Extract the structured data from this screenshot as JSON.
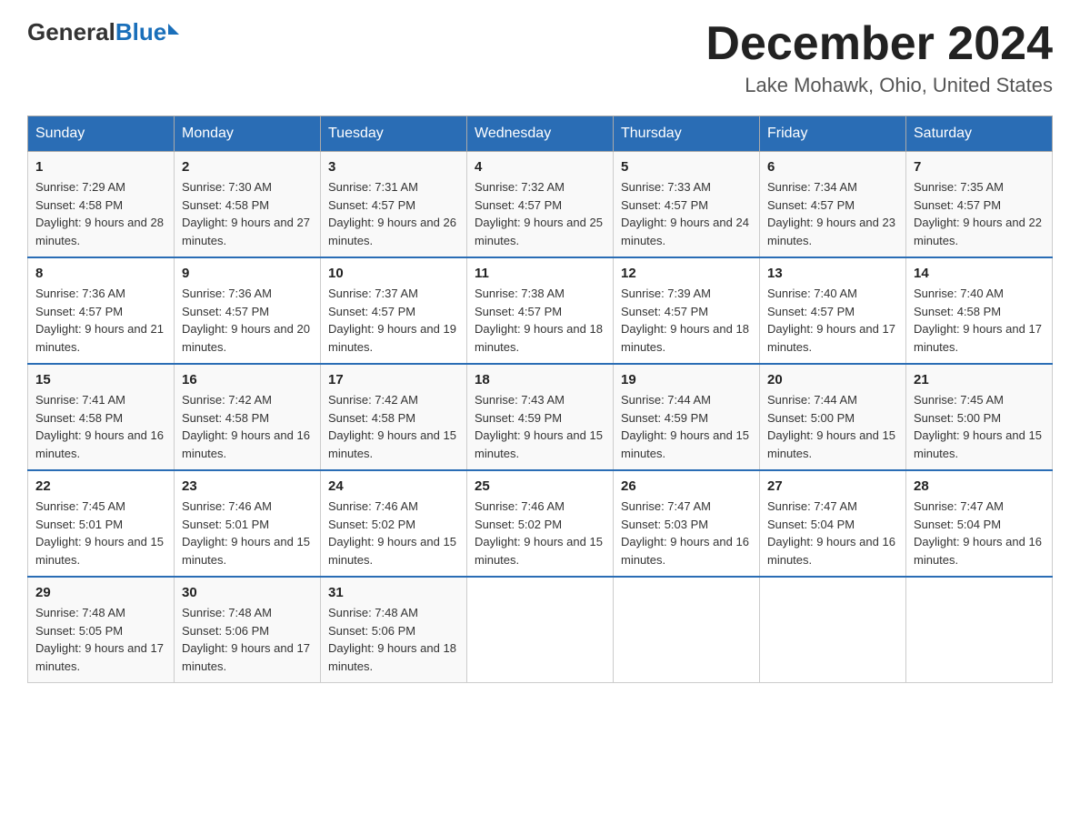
{
  "logo": {
    "general": "General",
    "blue": "Blue",
    "triangle": "▶"
  },
  "title": "December 2024",
  "subtitle": "Lake Mohawk, Ohio, United States",
  "weekdays": [
    "Sunday",
    "Monday",
    "Tuesday",
    "Wednesday",
    "Thursday",
    "Friday",
    "Saturday"
  ],
  "weeks": [
    [
      {
        "day": "1",
        "sunrise": "7:29 AM",
        "sunset": "4:58 PM",
        "daylight": "9 hours and 28 minutes."
      },
      {
        "day": "2",
        "sunrise": "7:30 AM",
        "sunset": "4:58 PM",
        "daylight": "9 hours and 27 minutes."
      },
      {
        "day": "3",
        "sunrise": "7:31 AM",
        "sunset": "4:57 PM",
        "daylight": "9 hours and 26 minutes."
      },
      {
        "day": "4",
        "sunrise": "7:32 AM",
        "sunset": "4:57 PM",
        "daylight": "9 hours and 25 minutes."
      },
      {
        "day": "5",
        "sunrise": "7:33 AM",
        "sunset": "4:57 PM",
        "daylight": "9 hours and 24 minutes."
      },
      {
        "day": "6",
        "sunrise": "7:34 AM",
        "sunset": "4:57 PM",
        "daylight": "9 hours and 23 minutes."
      },
      {
        "day": "7",
        "sunrise": "7:35 AM",
        "sunset": "4:57 PM",
        "daylight": "9 hours and 22 minutes."
      }
    ],
    [
      {
        "day": "8",
        "sunrise": "7:36 AM",
        "sunset": "4:57 PM",
        "daylight": "9 hours and 21 minutes."
      },
      {
        "day": "9",
        "sunrise": "7:36 AM",
        "sunset": "4:57 PM",
        "daylight": "9 hours and 20 minutes."
      },
      {
        "day": "10",
        "sunrise": "7:37 AM",
        "sunset": "4:57 PM",
        "daylight": "9 hours and 19 minutes."
      },
      {
        "day": "11",
        "sunrise": "7:38 AM",
        "sunset": "4:57 PM",
        "daylight": "9 hours and 18 minutes."
      },
      {
        "day": "12",
        "sunrise": "7:39 AM",
        "sunset": "4:57 PM",
        "daylight": "9 hours and 18 minutes."
      },
      {
        "day": "13",
        "sunrise": "7:40 AM",
        "sunset": "4:57 PM",
        "daylight": "9 hours and 17 minutes."
      },
      {
        "day": "14",
        "sunrise": "7:40 AM",
        "sunset": "4:58 PM",
        "daylight": "9 hours and 17 minutes."
      }
    ],
    [
      {
        "day": "15",
        "sunrise": "7:41 AM",
        "sunset": "4:58 PM",
        "daylight": "9 hours and 16 minutes."
      },
      {
        "day": "16",
        "sunrise": "7:42 AM",
        "sunset": "4:58 PM",
        "daylight": "9 hours and 16 minutes."
      },
      {
        "day": "17",
        "sunrise": "7:42 AM",
        "sunset": "4:58 PM",
        "daylight": "9 hours and 15 minutes."
      },
      {
        "day": "18",
        "sunrise": "7:43 AM",
        "sunset": "4:59 PM",
        "daylight": "9 hours and 15 minutes."
      },
      {
        "day": "19",
        "sunrise": "7:44 AM",
        "sunset": "4:59 PM",
        "daylight": "9 hours and 15 minutes."
      },
      {
        "day": "20",
        "sunrise": "7:44 AM",
        "sunset": "5:00 PM",
        "daylight": "9 hours and 15 minutes."
      },
      {
        "day": "21",
        "sunrise": "7:45 AM",
        "sunset": "5:00 PM",
        "daylight": "9 hours and 15 minutes."
      }
    ],
    [
      {
        "day": "22",
        "sunrise": "7:45 AM",
        "sunset": "5:01 PM",
        "daylight": "9 hours and 15 minutes."
      },
      {
        "day": "23",
        "sunrise": "7:46 AM",
        "sunset": "5:01 PM",
        "daylight": "9 hours and 15 minutes."
      },
      {
        "day": "24",
        "sunrise": "7:46 AM",
        "sunset": "5:02 PM",
        "daylight": "9 hours and 15 minutes."
      },
      {
        "day": "25",
        "sunrise": "7:46 AM",
        "sunset": "5:02 PM",
        "daylight": "9 hours and 15 minutes."
      },
      {
        "day": "26",
        "sunrise": "7:47 AM",
        "sunset": "5:03 PM",
        "daylight": "9 hours and 16 minutes."
      },
      {
        "day": "27",
        "sunrise": "7:47 AM",
        "sunset": "5:04 PM",
        "daylight": "9 hours and 16 minutes."
      },
      {
        "day": "28",
        "sunrise": "7:47 AM",
        "sunset": "5:04 PM",
        "daylight": "9 hours and 16 minutes."
      }
    ],
    [
      {
        "day": "29",
        "sunrise": "7:48 AM",
        "sunset": "5:05 PM",
        "daylight": "9 hours and 17 minutes."
      },
      {
        "day": "30",
        "sunrise": "7:48 AM",
        "sunset": "5:06 PM",
        "daylight": "9 hours and 17 minutes."
      },
      {
        "day": "31",
        "sunrise": "7:48 AM",
        "sunset": "5:06 PM",
        "daylight": "9 hours and 18 minutes."
      },
      null,
      null,
      null,
      null
    ]
  ],
  "labels": {
    "sunrise": "Sunrise:",
    "sunset": "Sunset:",
    "daylight": "Daylight:"
  }
}
